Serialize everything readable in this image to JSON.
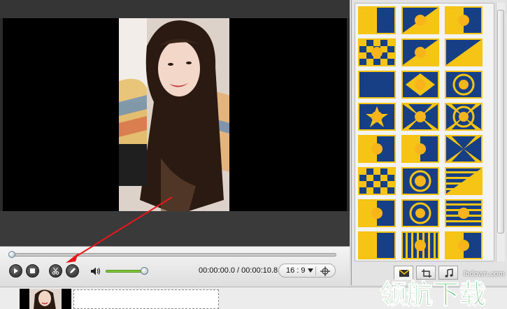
{
  "player": {
    "time_display": "00:00:00.0 / 00:00:10.8",
    "aspect_ratio": "16 : 9",
    "seek_progress": 0.0,
    "volume_level": 0.9
  },
  "controls": {
    "play_icon": "play-icon",
    "stop_icon": "stop-icon",
    "split_icon": "scissors-icon",
    "edit_icon": "pencil-icon",
    "volume_icon": "speaker-icon",
    "crop_icon": "crop-icon"
  },
  "effects": {
    "tiles": [
      [
        "moon-sun-a",
        "moon-sun-b",
        "moon-sun-c"
      ],
      [
        "checker-a",
        "split-a",
        "moon-sun-d"
      ],
      [
        "moon-sun-e",
        "diamond-sun",
        "ring-sun"
      ],
      [
        "star-sun",
        "burst-sun",
        "swirl-sun"
      ],
      [
        "half-sun",
        "corner-sun",
        "ray-sun"
      ],
      [
        "checker-b",
        "target-sun",
        "stripe-sun"
      ],
      [
        "bar-sun",
        "moon-ring",
        "stripe-moon"
      ],
      [
        "moon-low",
        "stripe-half",
        "sun-corner"
      ]
    ],
    "tabs": [
      "transitions-icon",
      "crop-tab-icon",
      "music-icon"
    ]
  },
  "timeline": {
    "clip_icon": "video-thumbnail"
  },
  "watermark": {
    "url": "lhdown.com",
    "logo_text": "领航下载"
  },
  "colors": {
    "tile_border": "#f5c415",
    "tile_bg": "#173f86",
    "sun": "#f7b51b",
    "volume": "#7ec43a",
    "arrow": "#e8171b"
  }
}
